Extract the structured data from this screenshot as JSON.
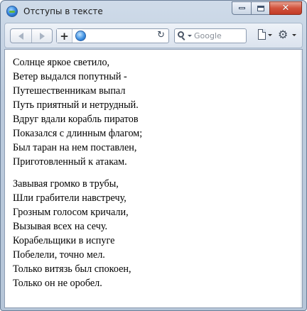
{
  "window": {
    "title": "Отступы в тексте",
    "close_glyph": "✕"
  },
  "toolbar": {
    "new_tab_glyph": "+",
    "reload_glyph": "↻",
    "gear_glyph": "⚙",
    "search": {
      "placeholder": "Google"
    },
    "icons": [
      "back-icon",
      "forward-icon",
      "globe-icon",
      "reload-icon",
      "search-icon",
      "page-menu-icon",
      "gear-icon"
    ]
  },
  "poem": {
    "stanza1": [
      "Солнце яркое светило,",
      "Ветер выдался попутный -",
      "Путешественникам выпал",
      "Путь приятный и нетрудный.",
      "Вдруг вдали корабль пиратов",
      "Показался с длинным флагом;",
      "Был таран на нем поставлен,",
      "Приготовленный к атакам."
    ],
    "stanza2": [
      "Завывая громко в трубы,",
      "Шли грабители навстречу,",
      "Грозным голосом кричали,",
      "Вызывая всех на сечу.",
      "Корабельщики в испуге",
      "Побелели, точно мел.",
      "Только витязь был спокоен,",
      "Только он не оробел."
    ]
  },
  "colors": {
    "frame": "#b5c5d8",
    "close_button": "#c23b26",
    "text": "#000000"
  }
}
